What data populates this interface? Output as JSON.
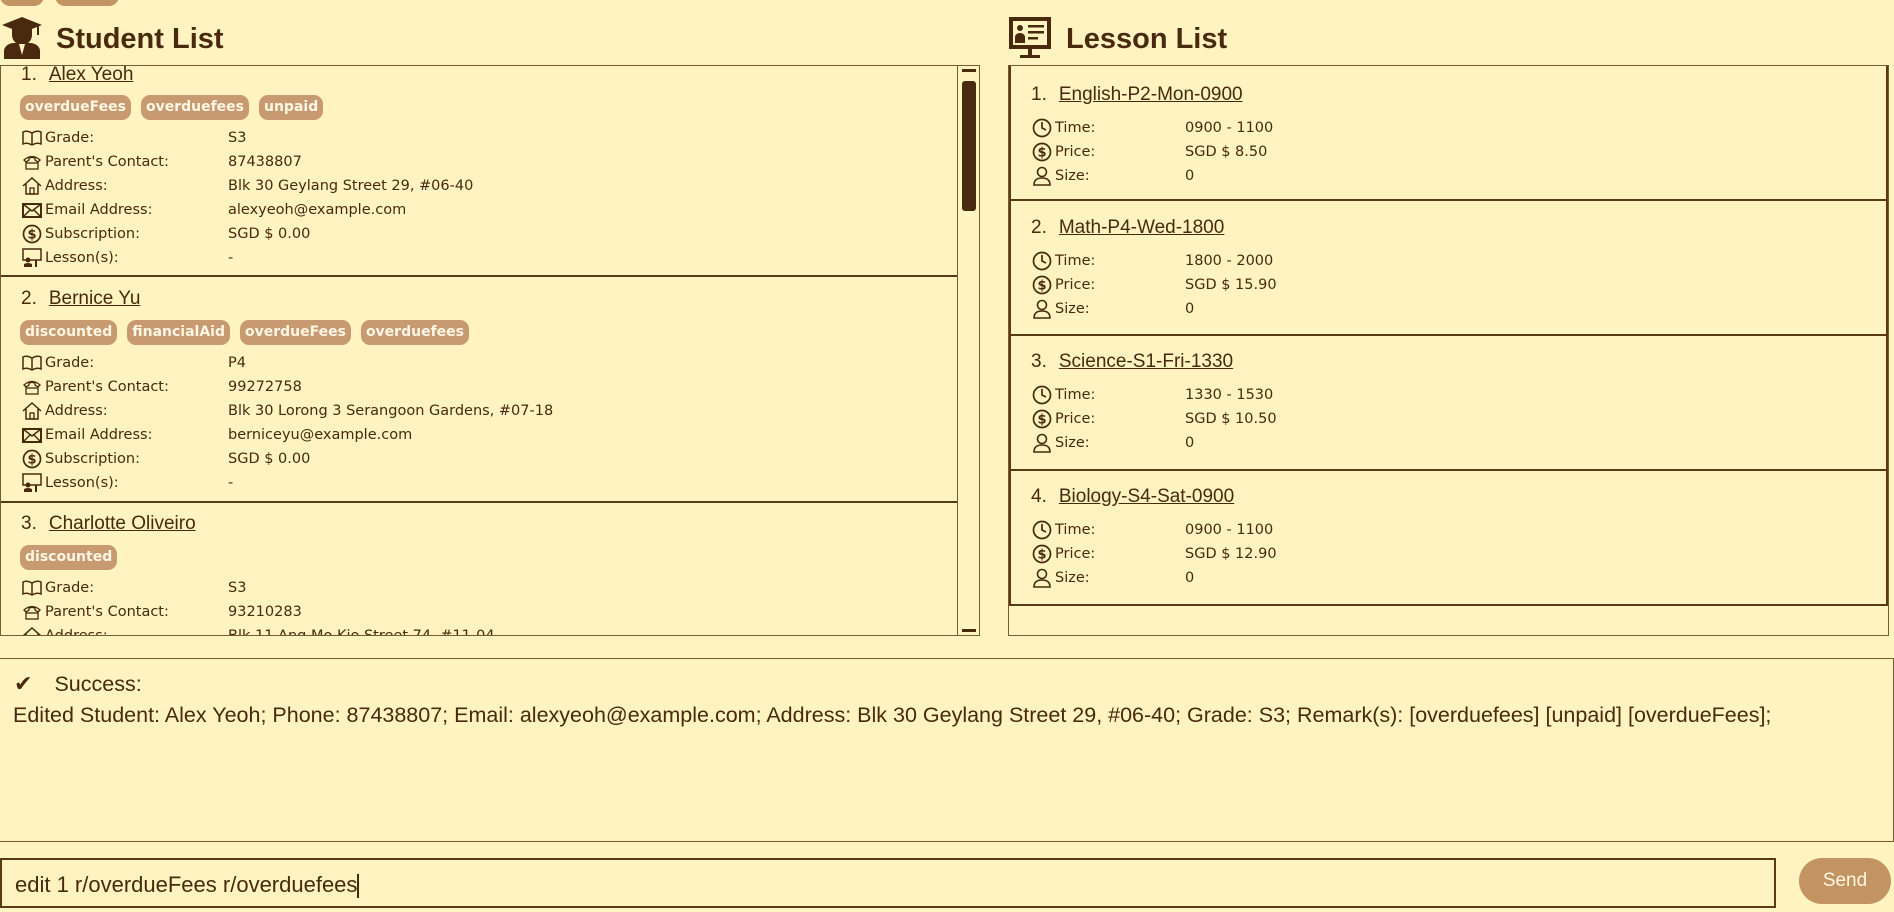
{
  "student_panel": {
    "title": "Student List",
    "labels": {
      "grade": "Grade:",
      "contact": "Parent's Contact:",
      "address": "Address:",
      "email": "Email Address:",
      "subscription": "Subscription:",
      "lessons": "Lesson(s):"
    },
    "students": [
      {
        "index": "1.",
        "name": "Alex Yeoh",
        "tags": [
          "overdueFees",
          "overduefees",
          "unpaid"
        ],
        "grade": "S3",
        "contact": "87438807",
        "address": "Blk 30 Geylang Street 29, #06-40",
        "email": "alexyeoh@example.com",
        "subscription": "SGD $ 0.00",
        "lessons": "-"
      },
      {
        "index": "2.",
        "name": "Bernice Yu",
        "tags": [
          "discounted",
          "financialAid",
          "overdueFees",
          "overduefees"
        ],
        "grade": "P4",
        "contact": "99272758",
        "address": "Blk 30 Lorong 3 Serangoon Gardens, #07-18",
        "email": "berniceyu@example.com",
        "subscription": "SGD $ 0.00",
        "lessons": "-"
      },
      {
        "index": "3.",
        "name": "Charlotte Oliveiro",
        "tags": [
          "discounted"
        ],
        "grade": "S3",
        "contact": "93210283",
        "address": "Blk 11 Ang Mo Kio Street 74, #11-04"
      }
    ]
  },
  "lesson_panel": {
    "title": "Lesson List",
    "labels": {
      "time": "Time:",
      "price": "Price:",
      "size": "Size:"
    },
    "lessons": [
      {
        "index": "1.",
        "name": "English-P2-Mon-0900",
        "time": "0900 - 1100",
        "price": "SGD $ 8.50",
        "size": "0"
      },
      {
        "index": "2.",
        "name": "Math-P4-Wed-1800",
        "time": "1800 - 2000",
        "price": "SGD $ 15.90",
        "size": "0"
      },
      {
        "index": "3.",
        "name": "Science-S1-Fri-1330",
        "time": "1330 - 1530",
        "price": "SGD $ 10.50",
        "size": "0"
      },
      {
        "index": "4.",
        "name": "Biology-S4-Sat-0900",
        "time": "0900 - 1100",
        "price": "SGD $ 12.90",
        "size": "0"
      }
    ]
  },
  "result": {
    "status": "Success:",
    "message": "Edited Student: Alex Yeoh; Phone: 87438807; Email: alexyeoh@example.com; Address: Blk 30 Geylang Street 29, #06-40; Grade: S3; Remark(s): [overduefees] [unpaid] [overdueFees];"
  },
  "command": {
    "value": "edit 1 r/overdueFees r/overduefees",
    "send_label": "Send"
  },
  "colors": {
    "background": "#fff3c2",
    "text": "#4a2a0e",
    "tag": "#c79a72",
    "button": "#c29461"
  }
}
